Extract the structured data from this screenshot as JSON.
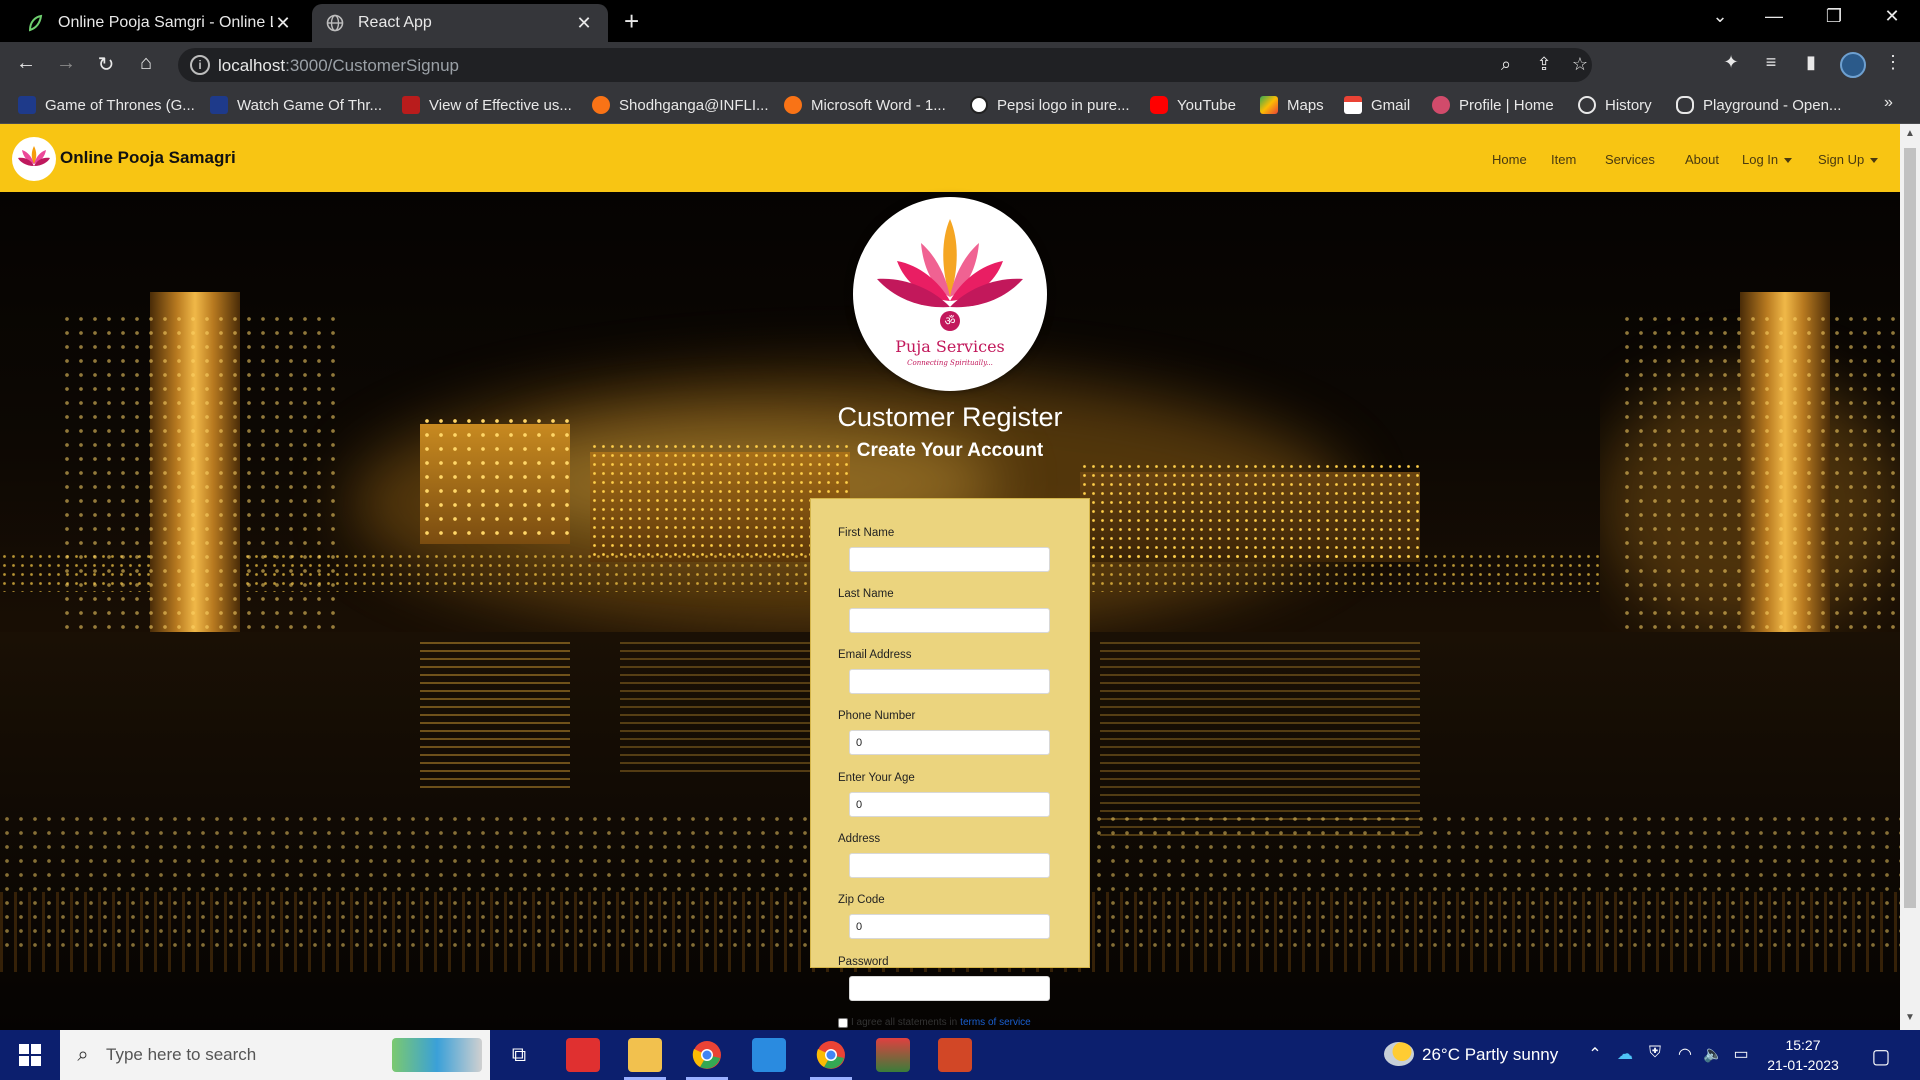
{
  "browser": {
    "tabs": [
      {
        "title": "Online Pooja Samgri - Online La",
        "active": false
      },
      {
        "title": "React App",
        "active": true
      }
    ],
    "address": {
      "host": "localhost",
      "path": ":3000/CustomerSignup"
    },
    "bookmarks": [
      {
        "label": "Game of Thrones (G...",
        "icon": "bh-icon",
        "color": "#1e3a8a"
      },
      {
        "label": "Watch Game Of Thr...",
        "icon": "bh-icon",
        "color": "#1e3a8a"
      },
      {
        "label": "View of Effective us...",
        "icon": "fm-icon",
        "color": "#b91c1c"
      },
      {
        "label": "Shodhganga@INFLI...",
        "icon": "shodh-icon",
        "color": "#f97316"
      },
      {
        "label": "Microsoft Word - 1...",
        "icon": "shodh-icon",
        "color": "#f97316"
      },
      {
        "label": "Pepsi logo in pure...",
        "icon": "codepen-icon",
        "color": "#222222"
      },
      {
        "label": "YouTube",
        "icon": "youtube-icon",
        "color": "#ff0000"
      },
      {
        "label": "Maps",
        "icon": "maps-icon",
        "color": "#34a853"
      },
      {
        "label": "Gmail",
        "icon": "gmail-icon",
        "color": "#ea4335"
      },
      {
        "label": "Profile | Home",
        "icon": "gear-icon",
        "color": "#d14b6b"
      },
      {
        "label": "History",
        "icon": "history-icon",
        "color": "#e8e8e8"
      },
      {
        "label": "Playground - Open...",
        "icon": "openai-icon",
        "color": "#e8e8e8"
      }
    ]
  },
  "site": {
    "brand": "Online Pooja Samagri",
    "nav": [
      {
        "label": "Home",
        "dropdown": false
      },
      {
        "label": "Item",
        "dropdown": false
      },
      {
        "label": "Services",
        "dropdown": false
      },
      {
        "label": "About",
        "dropdown": false
      },
      {
        "label": "Log In",
        "dropdown": true
      },
      {
        "label": "Sign Up",
        "dropdown": true
      }
    ],
    "accent": "#f8c513"
  },
  "main": {
    "logo_title": "Puja Services",
    "logo_tagline": "Connecting Spiritually...",
    "title": "Customer Register",
    "subtitle": "Create Your Account",
    "form": {
      "fields": [
        {
          "label": "First Name",
          "value": ""
        },
        {
          "label": "Last Name",
          "value": ""
        },
        {
          "label": "Email Address",
          "value": ""
        },
        {
          "label": "Phone Number",
          "value": "0"
        },
        {
          "label": "Enter Your Age",
          "value": "0"
        },
        {
          "label": "Address",
          "value": ""
        },
        {
          "label": "Zip Code",
          "value": "0"
        },
        {
          "label": "Password",
          "value": ""
        }
      ],
      "agree_text": "I agree all statements in",
      "agree_link": "terms of service"
    }
  },
  "taskbar": {
    "search_placeholder": "Type here to search",
    "weather": "26°C  Partly sunny",
    "time": "15:27",
    "date": "21-01-2023"
  }
}
